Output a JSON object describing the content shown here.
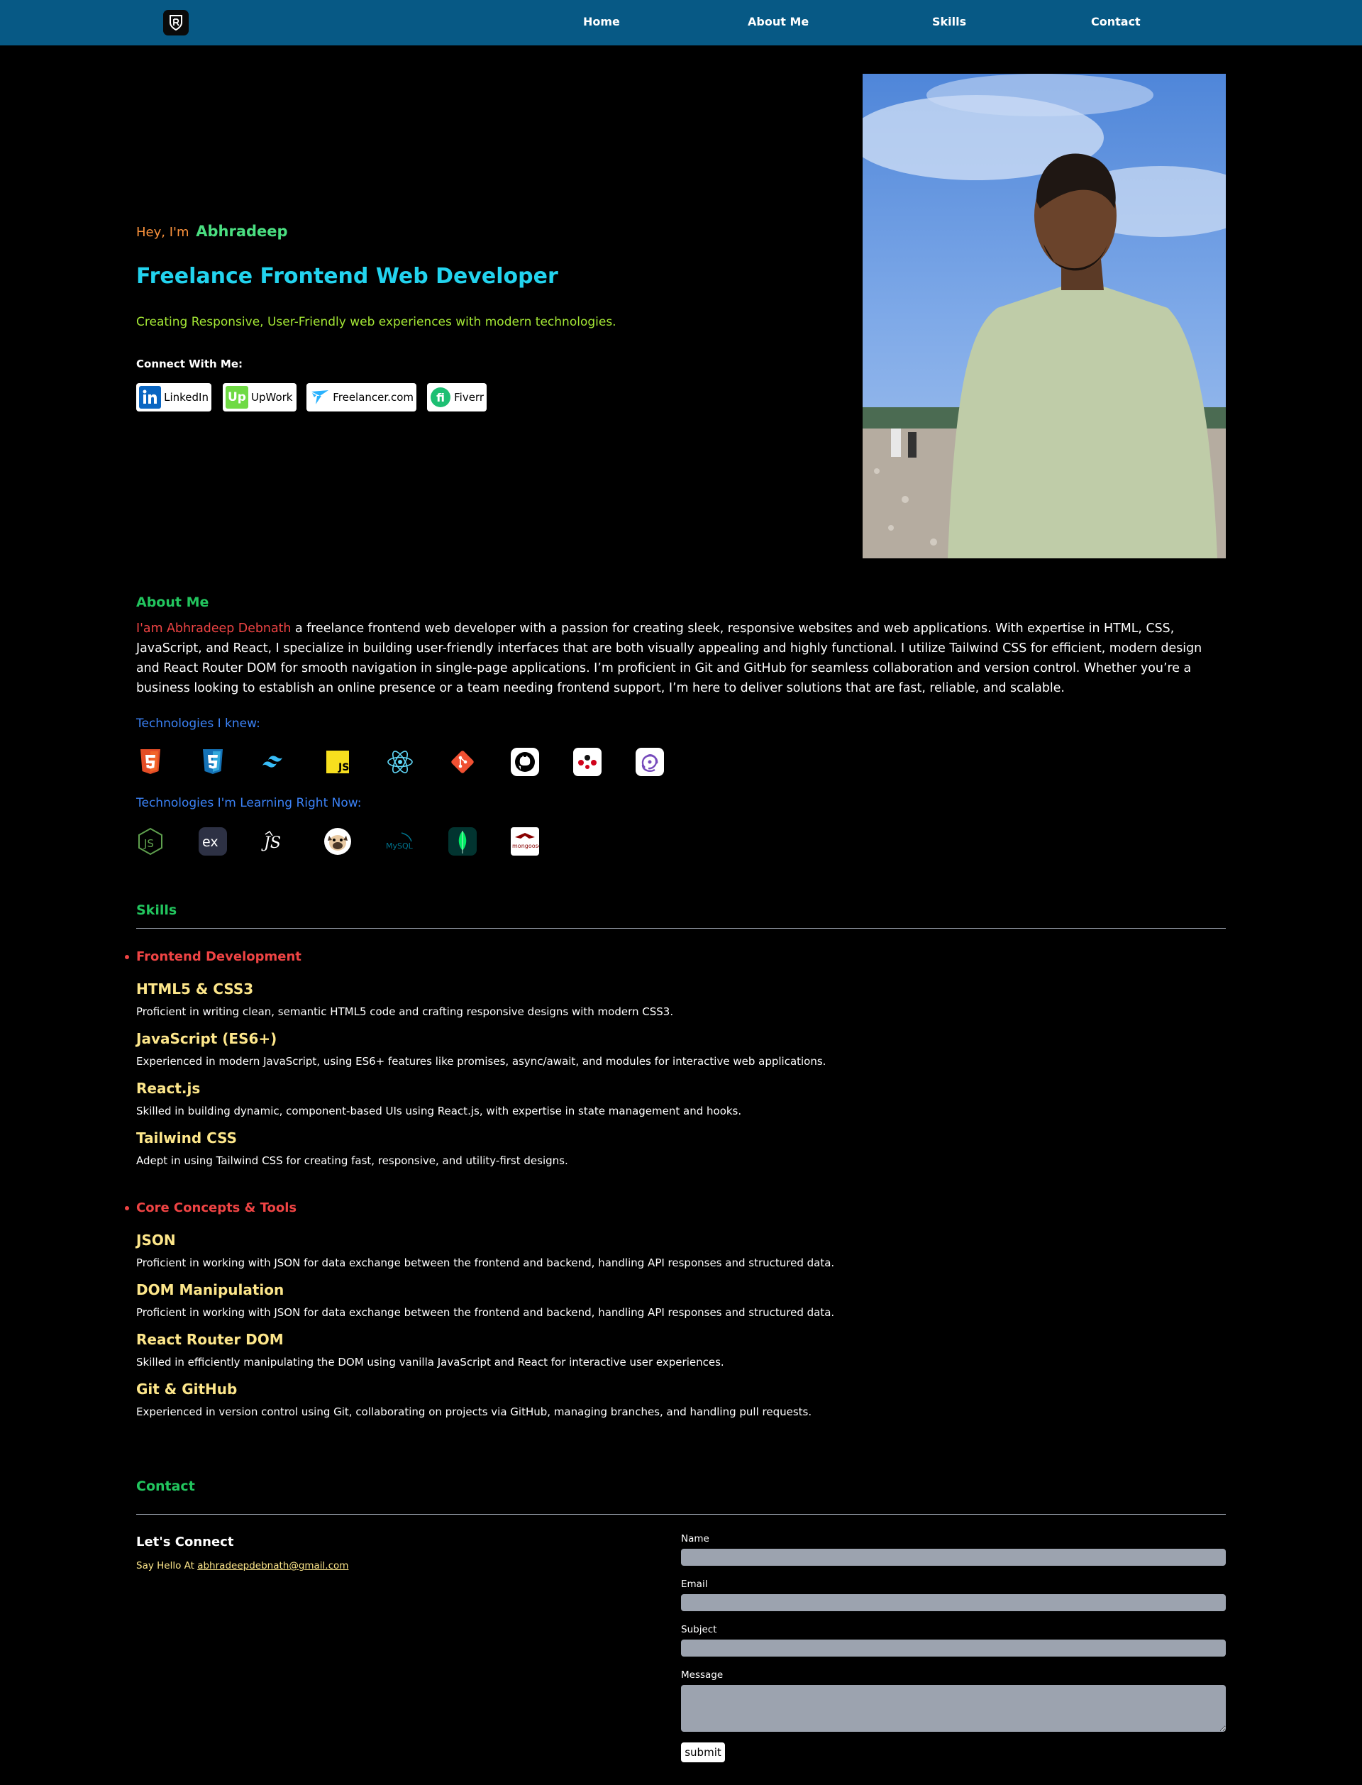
{
  "nav": {
    "logo_icon": "shield-logo-icon",
    "links": [
      "Home",
      "About Me",
      "Skills",
      "Contact"
    ]
  },
  "hero": {
    "greeting": "Hey, I'm",
    "name": "Abhradeep",
    "title": "Freelance Frontend Web Developer",
    "subtitle": "Creating Responsive, User-Friendly web experiences with modern technologies.",
    "connect_label": "Connect With Me:",
    "socials": [
      {
        "label": "LinkedIn",
        "icon": "linkedin-icon"
      },
      {
        "label": "UpWork",
        "icon": "upwork-icon"
      },
      {
        "label": "Freelancer.com",
        "icon": "freelancer-icon"
      },
      {
        "label": "Fiverr",
        "icon": "fiverr-icon"
      }
    ],
    "photo": "profile-photo"
  },
  "about": {
    "title": "About Me",
    "intro_highlight": "I'am Abhradeep Debnath",
    "intro_rest": " a freelance frontend web developer with a passion for creating sleek, responsive websites and web applications. With expertise in HTML, CSS, JavaScript, and React, I specialize in building user-friendly interfaces that are both visually appealing and highly functional. I utilize Tailwind CSS for efficient, modern design and React Router DOM for smooth navigation in single-page applications. I’m proficient in Git and GitHub for seamless collaboration and version control. Whether you’re a business looking to establish an online presence or a team needing frontend support, I’m here to deliver solutions that are fast, reliable, and scalable.",
    "known_label": "Technologies I knew:",
    "known_icons": [
      "html5-icon",
      "css3-icon",
      "tailwind-icon",
      "javascript-icon",
      "react-icon",
      "git-icon",
      "github-icon",
      "react-router-icon",
      "redux-icon"
    ],
    "learning_label": "Technologies I'm Learning Right Now:",
    "learning_icons": [
      "nodejs-icon",
      "express-icon",
      "nestjs-icon",
      "pug-icon",
      "mysql-icon",
      "mongodb-icon",
      "mongoose-icon"
    ],
    "mysql_text": "MySQL",
    "mongoose_text": "mongoose"
  },
  "skills": {
    "title": "Skills",
    "categories": [
      {
        "name": "Frontend Development",
        "items": [
          {
            "name": "HTML5 & CSS3",
            "desc": "Proficient in writing clean, semantic HTML5 code and crafting responsive designs with modern CSS3."
          },
          {
            "name": "JavaScript (ES6+)",
            "desc": "Experienced in modern JavaScript, using ES6+ features like promises, async/await, and modules for interactive web applications."
          },
          {
            "name": "React.js",
            "desc": "Skilled in building dynamic, component-based UIs using React.js, with expertise in state management and hooks."
          },
          {
            "name": "Tailwind CSS",
            "desc": "Adept in using Tailwind CSS for creating fast, responsive, and utility-first designs."
          }
        ]
      },
      {
        "name": "Core Concepts & Tools",
        "items": [
          {
            "name": "JSON",
            "desc": "Proficient in working with JSON for data exchange between the frontend and backend, handling API responses and structured data."
          },
          {
            "name": "DOM Manipulation",
            "desc": "Proficient in working with JSON for data exchange between the frontend and backend, handling API responses and structured data."
          },
          {
            "name": "React Router DOM",
            "desc": "Skilled in efficiently manipulating the DOM using vanilla JavaScript and React for interactive user experiences."
          },
          {
            "name": "Git & GitHub",
            "desc": "Experienced in version control using Git, collaborating on projects via GitHub, managing branches, and handling pull requests."
          }
        ]
      }
    ]
  },
  "contact": {
    "title": "Contact",
    "lets_connect": "Let's Connect",
    "say_hello": "Say Hello At ",
    "email": "abhradeepdebnath@gmail.com",
    "form": {
      "name_label": "Name",
      "email_label": "Email",
      "subject_label": "Subject",
      "message_label": "Message",
      "submit_label": "submit"
    }
  },
  "colors": {
    "nav_bg": "#075985",
    "accent_green": "#22c55e",
    "accent_cyan": "#22d3ee",
    "accent_red": "#ef4444",
    "accent_yellow": "#fde68a",
    "accent_blue": "#3b82f6"
  }
}
